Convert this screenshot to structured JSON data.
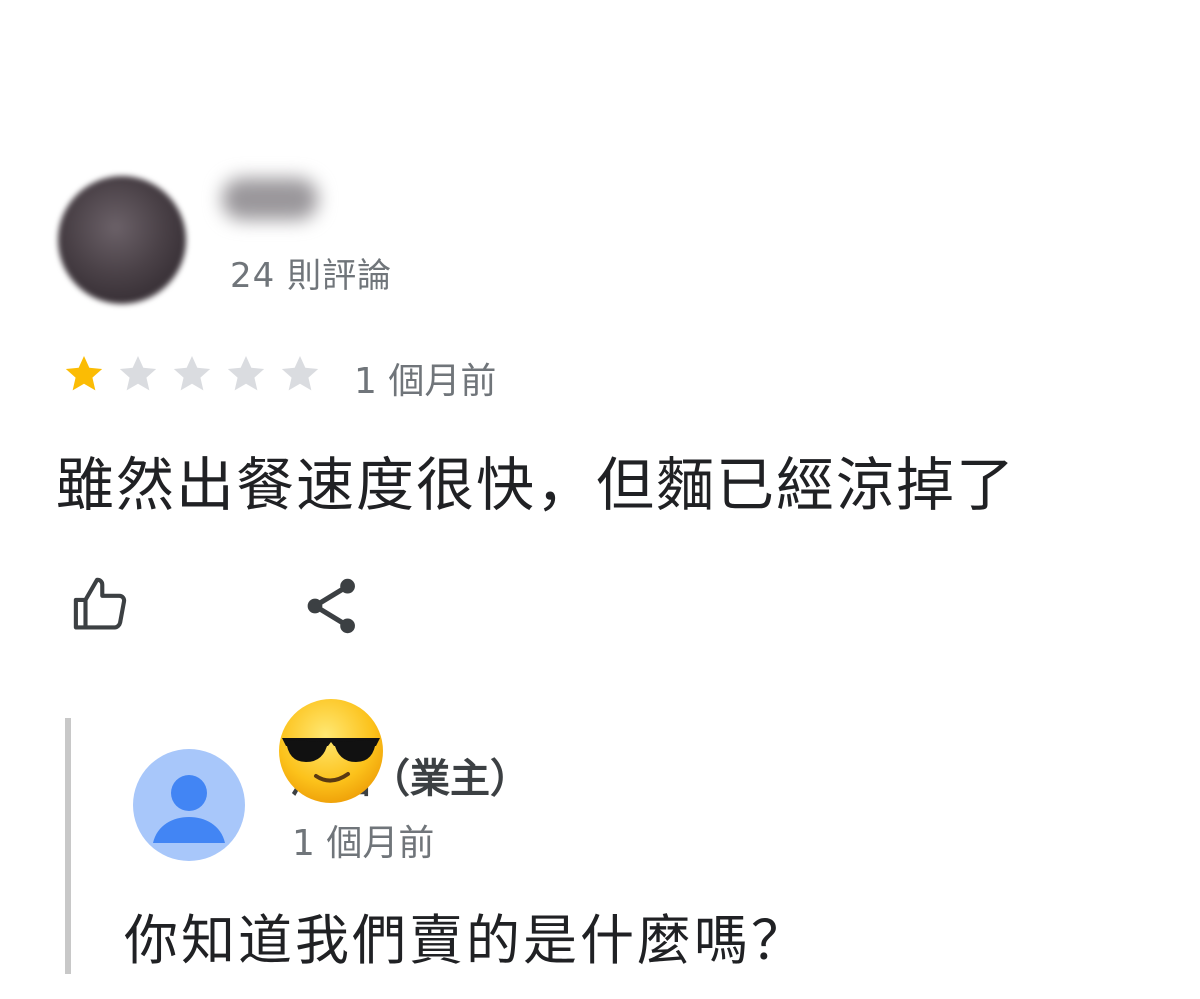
{
  "review": {
    "review_count": "24 則評論",
    "rating": 1,
    "rating_max": 5,
    "time": "1 個月前",
    "text": "雖然出餐速度很快，但麵已經涼掉了",
    "actions": [
      {
        "icon": "thumbs-up-icon"
      },
      {
        "icon": "share-icon"
      }
    ],
    "colors": {
      "star_filled": "#fbbc04",
      "star_empty": "#dadce0",
      "secondary_text": "#70757a"
    }
  },
  "owner_reply": {
    "name": "涼麵（業主）",
    "time": "1 個月前",
    "text": "你知道我們賣的是什麼嗎？",
    "avatar_icon": "person-icon",
    "overlay_icon": "sunglasses-emoji-icon",
    "colors": {
      "avatar_bg": "#a8c7fa",
      "avatar_fg": "#4285f4"
    }
  }
}
